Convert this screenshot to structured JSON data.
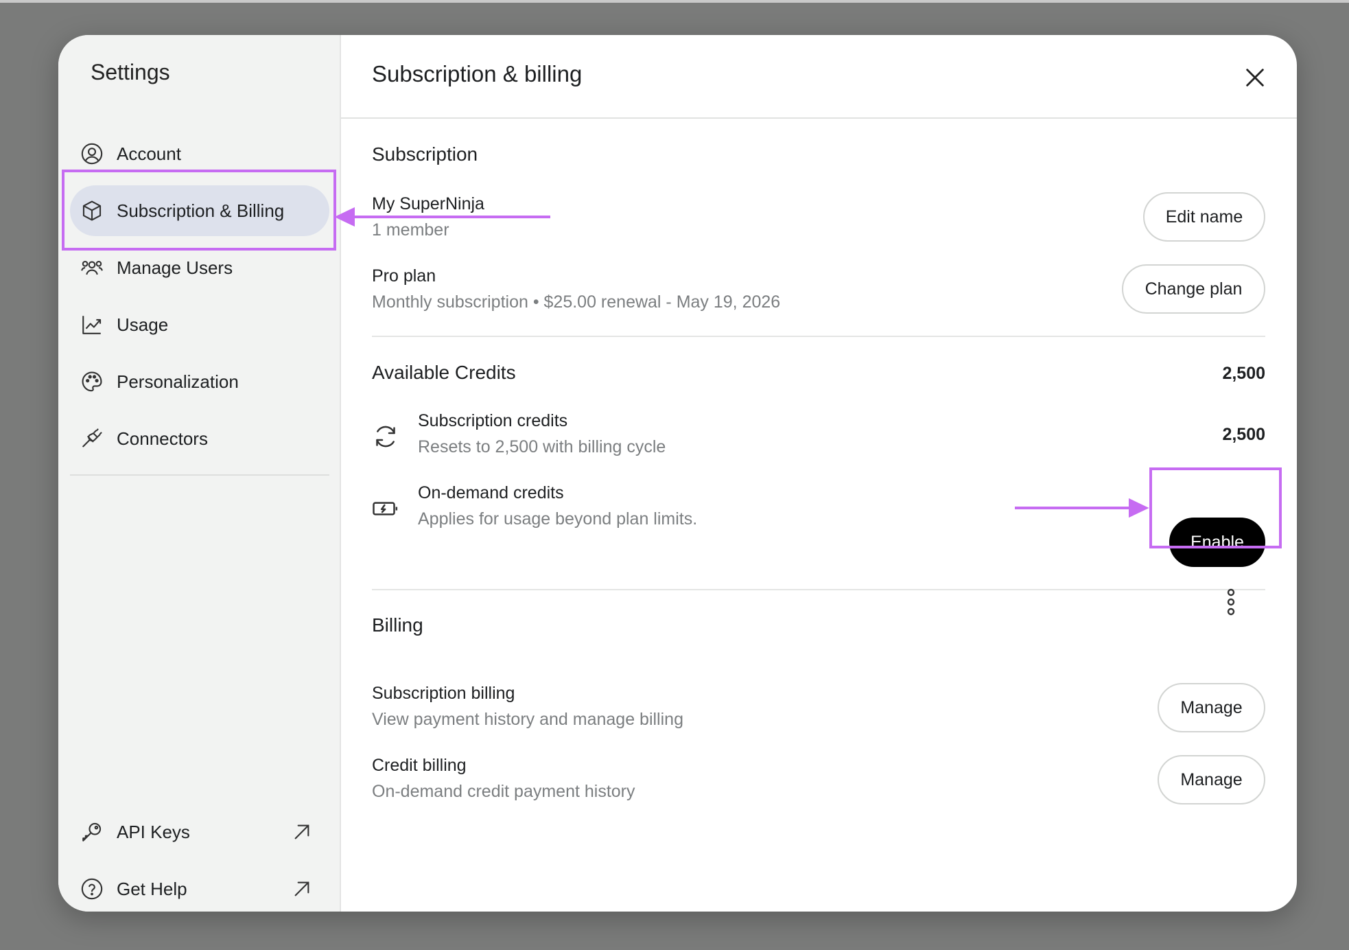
{
  "sidebar": {
    "title": "Settings",
    "items": [
      {
        "label": "Account",
        "icon": "user-circle-icon"
      },
      {
        "label": "Subscription & Billing",
        "icon": "box-icon",
        "active": true
      },
      {
        "label": "Manage Users",
        "icon": "users-icon"
      },
      {
        "label": "Usage",
        "icon": "chart-line-icon"
      },
      {
        "label": "Personalization",
        "icon": "palette-icon"
      },
      {
        "label": "Connectors",
        "icon": "plug-icon"
      }
    ],
    "footer_items": [
      {
        "label": "API Keys",
        "icon": "key-icon",
        "external": true
      },
      {
        "label": "Get Help",
        "icon": "help-circle-icon",
        "external": true
      }
    ]
  },
  "main": {
    "title": "Subscription & billing",
    "subscription": {
      "heading": "Subscription",
      "name": "My SuperNinja",
      "members": "1 member",
      "edit_label": "Edit name",
      "plan": "Pro plan",
      "plan_detail": "Monthly subscription • $25.00 renewal - May 19, 2026",
      "change_label": "Change plan"
    },
    "credits": {
      "heading": "Available Credits",
      "total": "2,500",
      "subscription_title": "Subscription credits",
      "subscription_sub": "Resets to 2,500 with billing cycle",
      "subscription_value": "2,500",
      "ondemand_title": "On-demand credits",
      "ondemand_sub": "Applies for usage beyond plan limits.",
      "enable_label": "Enable"
    },
    "billing": {
      "heading": "Billing",
      "sub_title": "Subscription billing",
      "sub_desc": "View payment history and manage billing",
      "sub_button": "Manage",
      "credit_title": "Credit billing",
      "credit_desc": "On-demand credit payment history",
      "credit_button": "Manage"
    }
  },
  "colors": {
    "highlight": "#c66cf2",
    "active_nav": "#dde1ec",
    "primary_button": "#000000"
  }
}
